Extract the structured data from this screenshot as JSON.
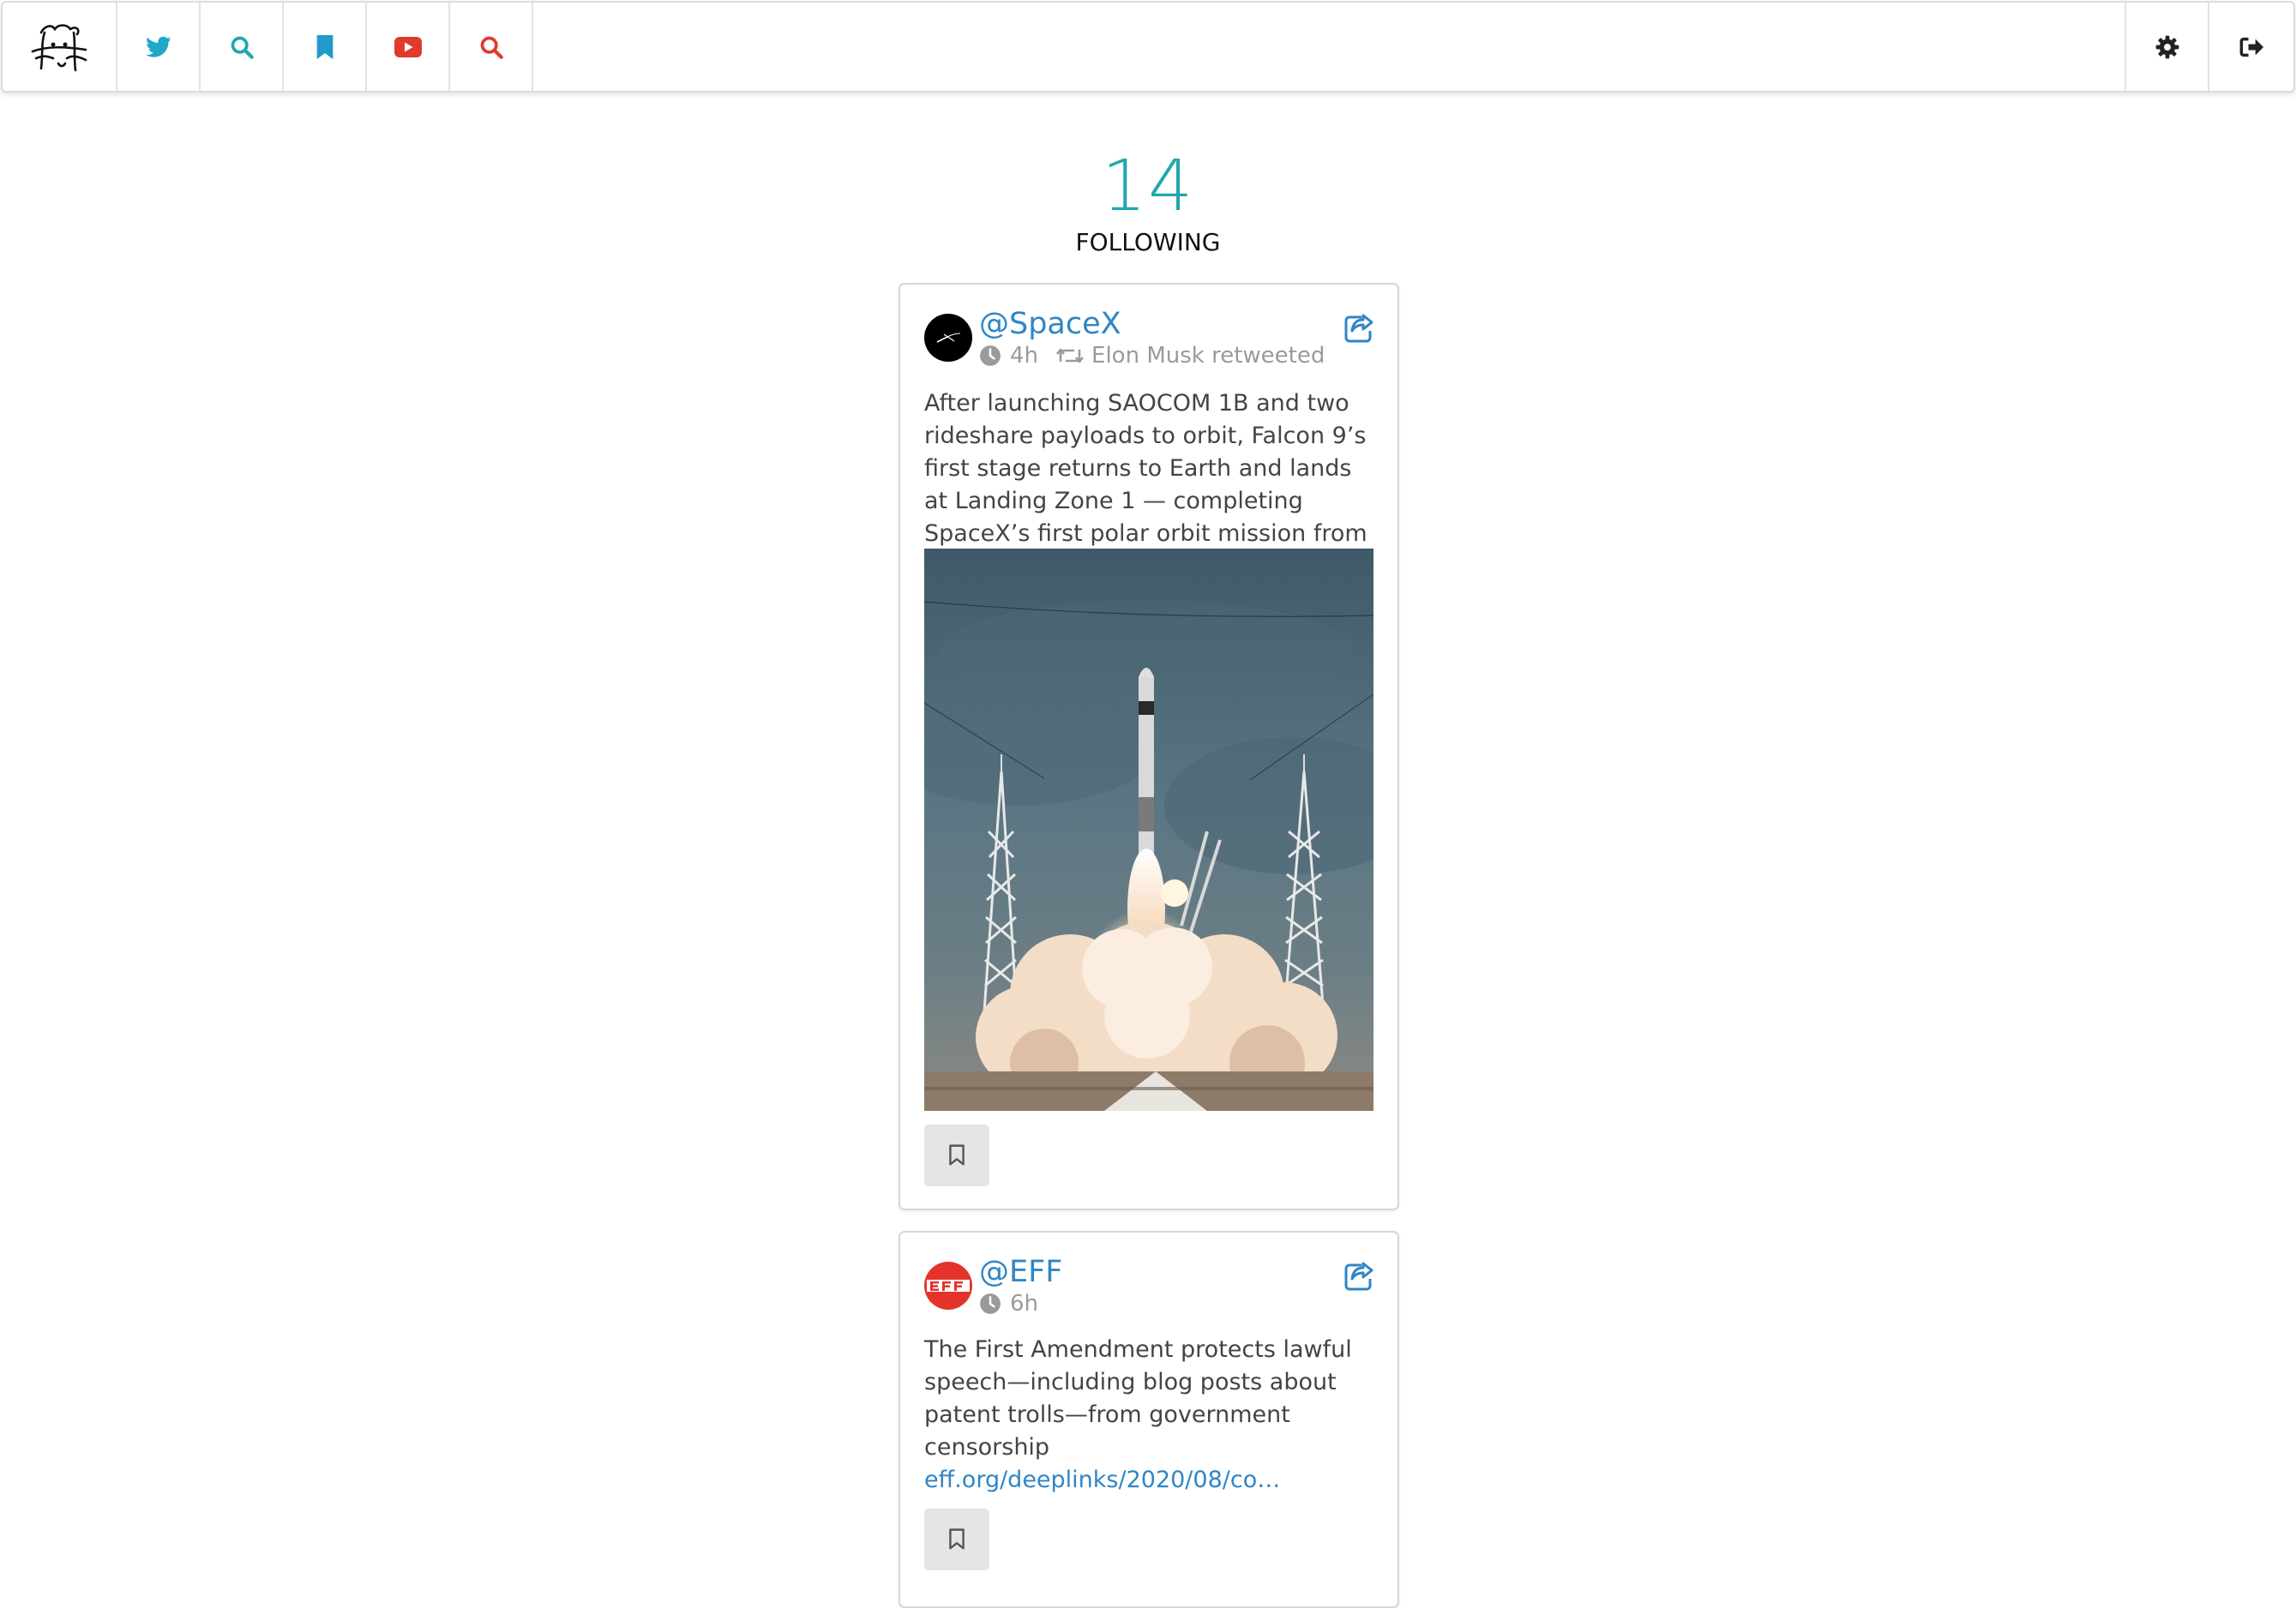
{
  "nav": {
    "items": [
      {
        "icon": "twitter-icon",
        "color": "#1fa8c9"
      },
      {
        "icon": "search-icon",
        "color": "#1fa8ad"
      },
      {
        "icon": "bookmark-icon",
        "color": "#1f9bc9"
      },
      {
        "icon": "youtube-icon",
        "color": "#e03a2d"
      },
      {
        "icon": "search-icon",
        "color": "#e03a2d"
      }
    ],
    "right_items": [
      {
        "icon": "gear-icon"
      },
      {
        "icon": "sign-out-icon"
      }
    ]
  },
  "summary": {
    "count": "14",
    "label": "FOLLOWING"
  },
  "tweets": [
    {
      "handle": "@SpaceX",
      "time": "4h",
      "retweeted_by": "Elon Musk retweeted",
      "text": "After launching SAOCOM 1B and two rideshare payloads to orbit, Falcon 9’s first stage returns to Earth and lands at Landing Zone 1 — completing SpaceX’s first polar orbit mission from Florida",
      "avatar_icon": "spacex-logo-icon",
      "media": "rocket-launch-photo"
    },
    {
      "handle": "@EFF",
      "time": "6h",
      "text": "The First Amendment protects lawful speech—including blog posts about patent trolls—from government censorship",
      "link": "eff.org/deeplinks/2020/08/co…",
      "avatar_icon": "eff-logo-icon"
    }
  ],
  "colors": {
    "accent": "#1fa8ad",
    "link": "#2f86c5",
    "meta": "#9a9a9a"
  }
}
